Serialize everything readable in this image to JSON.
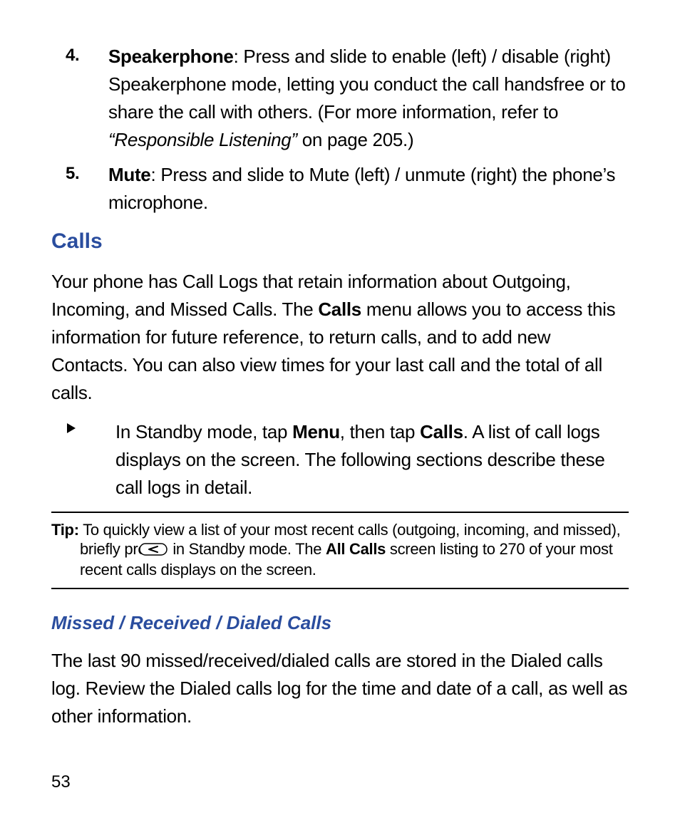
{
  "list": {
    "item4": {
      "num": "4.",
      "label": "Speakerphone",
      "text1": ": Press and slide to enable (left) / disable (right) Speakerphone mode, letting you conduct the call handsfree or to share the call with others. (For more information, refer to ",
      "ref": "“Responsible Listening”",
      "text2": " on page 205.)"
    },
    "item5": {
      "num": "5.",
      "label": "Mute",
      "text": ": Press and slide to Mute (left) / unmute (right) the phone’s microphone."
    }
  },
  "calls": {
    "heading": "Calls",
    "intro1": "Your phone has Call Logs that retain information about Outgoing, Incoming, and Missed Calls. The ",
    "intro_b": "Calls",
    "intro2": " menu allows you to access this information for future reference, to return calls, and to add new Contacts. You can also view times for your last call and the total of all calls.",
    "step_pre": "In Standby mode, tap ",
    "step_menu": "Menu",
    "step_mid": ", then tap ",
    "step_calls": "Calls",
    "step_post": ". A list of call logs displays on the screen. The following sections describe these call logs in detail."
  },
  "tip": {
    "label": "Tip:",
    "t1": " To quickly view a list of your most recent calls (outgoing, incoming, and missed), briefly press ",
    "t2": " in Standby mode. The ",
    "all": "All Calls",
    "t3": " screen listing to 270 of your most recent calls displays on the screen."
  },
  "missed": {
    "heading": "Missed / Received / Dialed Calls",
    "para": "The last 90 missed/received/dialed calls are stored in the Dialed calls log. Review the Dialed calls log for the time and date of a call, as well as other information."
  },
  "page_number": "53"
}
